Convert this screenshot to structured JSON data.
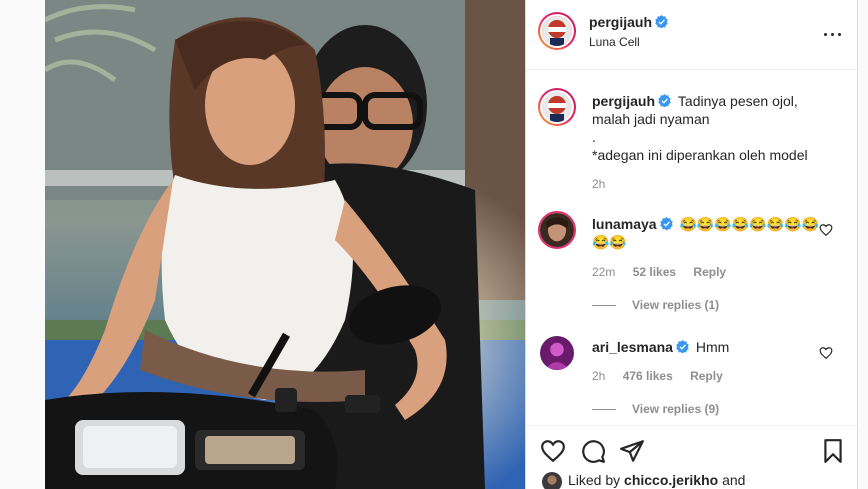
{
  "post": {
    "author": "pergijauh",
    "location": "Luna Cell",
    "caption_author": "pergijauh",
    "caption_line1": "Tadinya pesen ojol,",
    "caption_line2": "malah jadi nyaman",
    "caption_line3": ".",
    "caption_line4": "*adegan ini diperankan oleh model",
    "caption_time": "2h"
  },
  "comments": [
    {
      "user": "lunamaya",
      "text": "😂😂😂😂😂😂😂😂😂😂",
      "time": "22m",
      "likes": "52 likes",
      "reply": "Reply",
      "view_replies": "View replies (1)"
    },
    {
      "user": "ari_lesmana",
      "text": "Hmm",
      "time": "2h",
      "likes": "476 likes",
      "reply": "Reply",
      "view_replies": "View replies (9)"
    }
  ],
  "footer": {
    "liked_by_prefix": "Liked by",
    "liked_by_user": "chicco.jerikho",
    "liked_by_suffix": "and"
  },
  "colors": {
    "verified": "#3897f0",
    "meta": "#8e8e8e",
    "text": "#262626",
    "border": "#dbdbdb"
  },
  "icons": {
    "more": "more-options-icon",
    "like": "heart-icon",
    "comment": "comment-icon",
    "share": "paper-plane-icon",
    "save": "bookmark-icon",
    "verified": "verified-badge-icon"
  }
}
